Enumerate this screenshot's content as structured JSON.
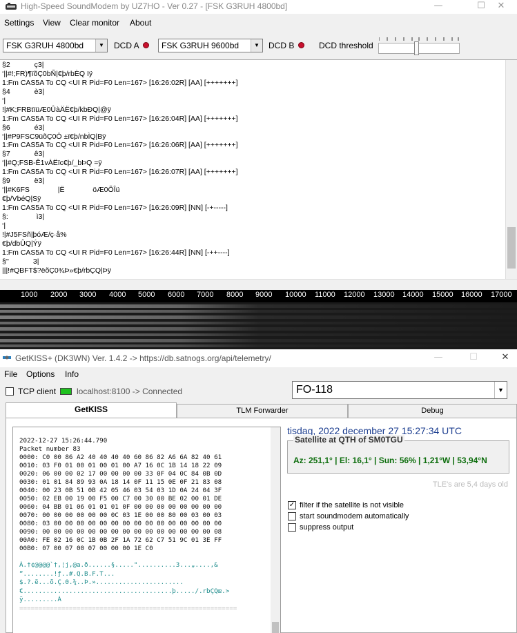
{
  "soundmodem": {
    "title": "High-Speed SoundModem by UZ7HO - Ver 0.27 - [FSK G3RUH 4800bd]",
    "window_controls": [
      "—",
      "☐",
      "✕"
    ],
    "menu": [
      "Settings",
      "View",
      "Clear monitor",
      "About"
    ],
    "modem_a": "FSK G3RUH 4800bd",
    "dcd_a_label": "DCD A",
    "modem_b": "FSK G3RUH 9600bd",
    "dcd_b_label": "DCD B",
    "dcd_threshold_label": "DCD threshold",
    "monitor_lines": [
      "§2            ç3|",
      "‘||#!;FR)¶ïõÇ0bÑ|€þ/rbÈQ Iÿ",
      "1:Fm CAS5A To CQ <UI R Pid=F0 Len=167> [16:26:02R] [AA] [+++++++]",
      "§4            è3|",
      "‘|",
      "!|#K;FRBtïüÆ0ÛàÄË€þ/kbÐQ|@ÿ",
      "1:Fm CAS5A To CQ <UI R Pid=F0 Len=167> [16:26:04R] [AA] [+++++++]",
      "§6            é3|",
      "‘||#P9FSC9üõÇ0Ö ±ï€þ/nbÌQ|Bÿ",
      "1:Fm CAS5A To CQ <UI R Pid=F0 Len=167> [16:26:06R] [AA] [+++++++]",
      "§7            ê3|",
      "‘||#Q;FSB-Ê1vÀËïc€þ/_bÞQ =ÿ",
      "1:Fm CAS5A To CQ <UI R Pid=F0 Len=167> [16:26:07R] [AA] [+++++++]",
      "§9            ë3|",
      "‘||#K6FS              |Ë              öÆ0ÕÎü",
      "€þ/VbéQ|Sÿ",
      "1:Fm CAS5A To CQ <UI R Pid=F0 Len=167> [16:26:09R] [NN] [-+-----]",
      "§:              ì3|",
      "‘|",
      "!|#J5FSñ|þóÆ/ç·å%",
      "€þ/dbÛQ|Ýÿ",
      "1:Fm CAS5A To CQ <UI R Pid=F0 Len=167> [16:26:44R] [NN] [-++----]",
      "§''            3|",
      "|||!#QBFT$?ëõÇ0¾Þ»€þ/rbÇQ|Þÿ"
    ],
    "ruler": [
      "1000",
      "2000",
      "3000",
      "4000",
      "5000",
      "6000",
      "7000",
      "8000",
      "9000",
      "10000",
      "11000",
      "12000",
      "13000",
      "14000",
      "15000",
      "16000",
      "17000"
    ]
  },
  "getkiss": {
    "title": "GetKISS+ (DK3WN) Ver. 1.4.2 -> https://db.satnogs.org/api/telemetry/",
    "window_controls": [
      "—",
      "☐",
      "✕"
    ],
    "menu": [
      "File",
      "Options",
      "Info"
    ],
    "tcp_client_label": "TCP client",
    "connection_status": "localhost:8100 -> Connected",
    "satellite": "FO-118",
    "tabs": [
      "GetKISS",
      "TLM Forwarder",
      "Debug"
    ],
    "hex_lines": [
      "2022-12-27 15:26:44.790",
      "Packet number 83",
      "0000: C0 00 86 A2 40 40 40 40 60 86 82 A6 6A 82 40 61",
      "0010: 03 F0 01 00 01 00 01 00 A7 16 0C 1B 14 18 22 09",
      "0020: 06 00 00 02 17 00 00 00 00 33 0F 04 0C 84 0B 0D",
      "0030: 01 01 84 89 93 0A 18 14 0F 11 15 0E 0F 21 83 08",
      "0040: 00 23 0B 51 0B 42 05 46 03 54 03 1D 0A 24 04 3F",
      "0050: 02 EB 00 19 00 F5 00 C7 00 30 00 BE 02 00 01 DE",
      "0060: 04 BB 01 06 01 01 01 0F 00 00 00 00 00 00 00 00",
      "0070: 00 00 00 00 00 00 0C 03 1E 00 00 80 00 03 00 03",
      "0080: 03 00 00 00 00 00 00 00 00 00 00 00 00 00 00 00",
      "0090: 00 00 00 00 00 00 00 00 00 00 00 00 00 00 00 08",
      "00A0: FE 02 16 0C 1B 0B 2F 1A 72 62 C7 51 9C 01 3E FF",
      "00B0: 07 00 07 00 07 00 00 00 1E C0"
    ],
    "ascii_lines": [
      "À.†¢@@@@`†,¦j‚@a.ð......§.....\"..........3...„....‚&",
      "“........!ƒ..#.Q.B.F.T...",
      "$.?.ë...õ.Ç.0.¾..Þ.».......................",
      "€.......................................þ...../.rbÇQœ.>",
      "ÿ.........À"
    ],
    "separator": "=========================================================",
    "datetime": "tisdag, 2022 december 27  15:27:34 UTC",
    "qth_caption": "Satellite at QTH of SM0TGU",
    "qth_position": "Az: 251,1° | El: 16,1° | Sun: 56% | 1,21°W | 53,94°N",
    "tle_age": "TLE's are 5,4 days old",
    "options": [
      {
        "label": "filter if the satellite is not visible",
        "checked": true
      },
      {
        "label": "start soundmodem automatically",
        "checked": false
      },
      {
        "label": "suppress output",
        "checked": false
      }
    ]
  },
  "colors": {
    "led_red": "#c8102e",
    "led_green": "#1fc11f",
    "datetime_blue": "#1b3d8f",
    "position_green": "#0c6d0c",
    "ascii_teal": "#1a8a8a"
  }
}
